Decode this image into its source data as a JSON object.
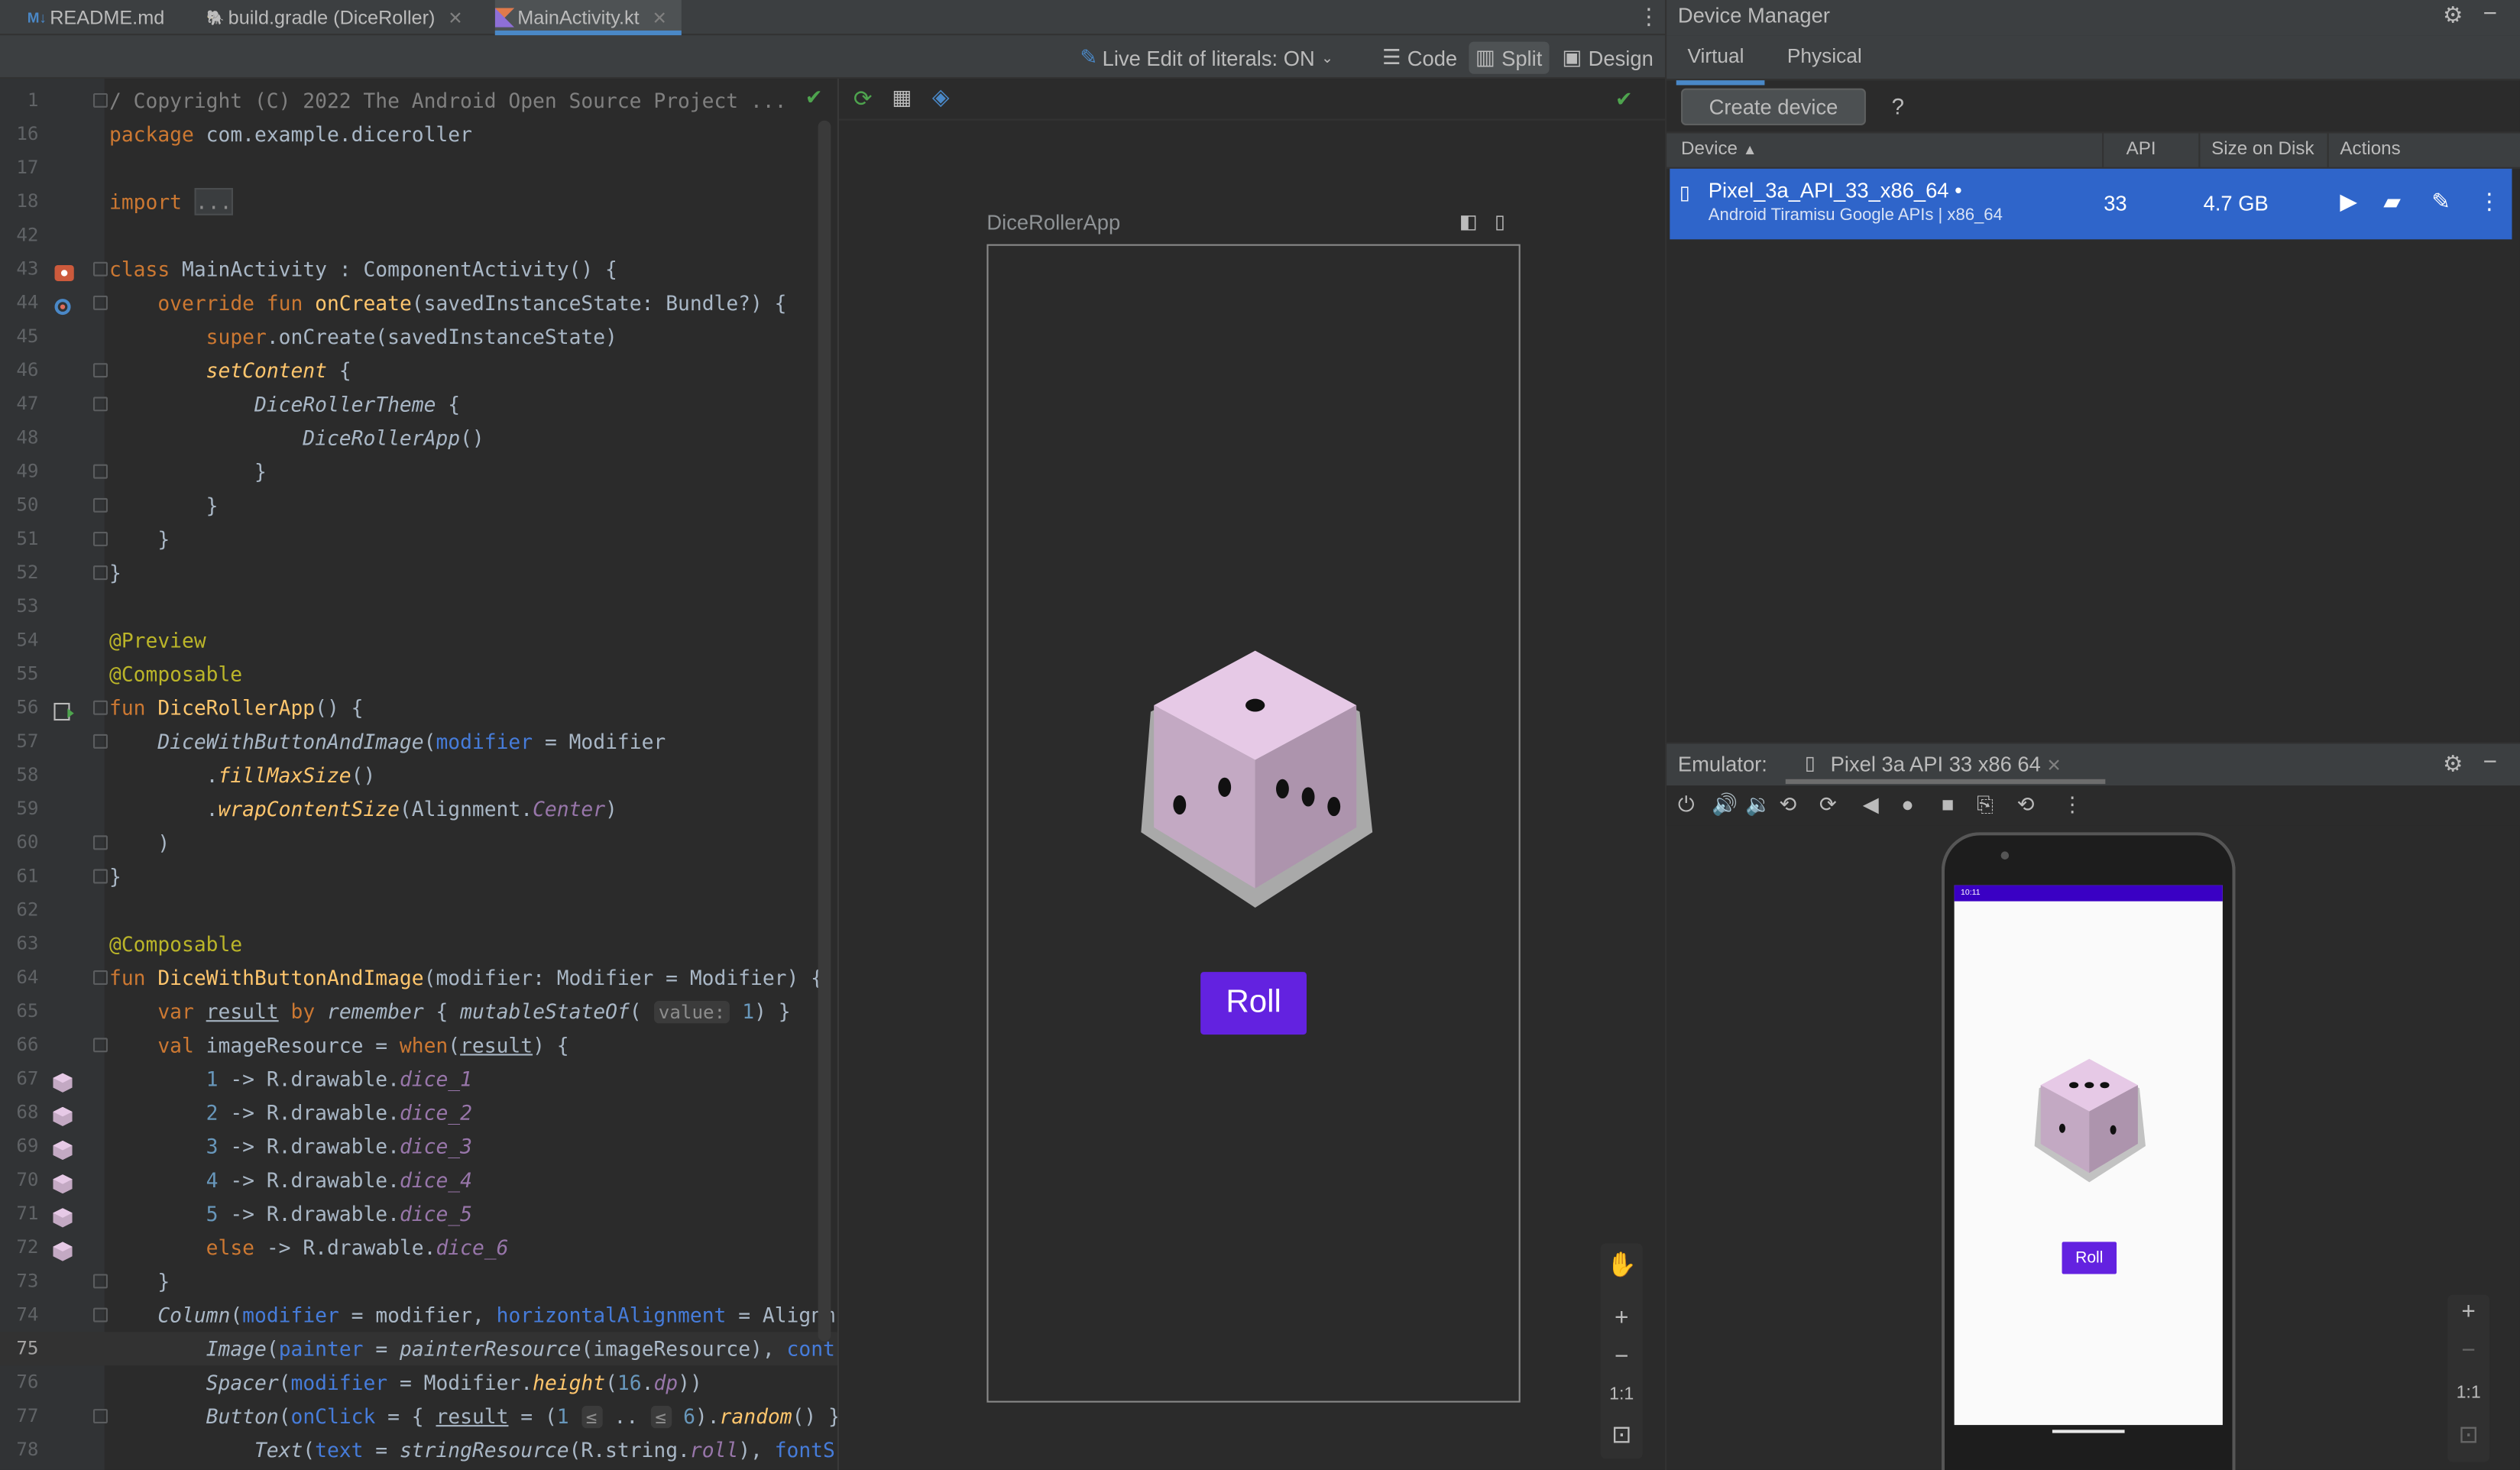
{
  "tabs": [
    {
      "label": "README.md",
      "icon": "markdown-icon"
    },
    {
      "label": "build.gradle (DiceRoller)",
      "icon": "gradle-icon"
    },
    {
      "label": "MainActivity.kt",
      "icon": "kotlin-file-icon"
    }
  ],
  "toolbar": {
    "live_edit": "Live Edit of literals: ON",
    "code": "Code",
    "split": "Split",
    "design": "Design"
  },
  "editor": {
    "current_line": "75",
    "lines": [
      {
        "n": "1",
        "html": "<span class=\"cm\">/ Copyright (C) 2022 The Android Open Source Project ...</span>"
      },
      {
        "n": "16",
        "html": "<span class=\"kw\">package</span> com.example.diceroller"
      },
      {
        "n": "17",
        "html": ""
      },
      {
        "n": "18",
        "html": "<span class=\"kw\">import</span> <span class=\"fold-box\">...</span>"
      },
      {
        "n": "42",
        "html": ""
      },
      {
        "n": "43",
        "html": "<span class=\"kw\">class</span> MainActivity : ComponentActivity() {"
      },
      {
        "n": "44",
        "html": "    <span class=\"kw\">override fun</span> <span class=\"fn\">onCreate</span>(savedInstanceState: Bundle?) {"
      },
      {
        "n": "45",
        "html": "        <span class=\"kw\">super</span>.onCreate(savedInstanceState)"
      },
      {
        "n": "46",
        "html": "        <span class=\"fn it\">setContent</span> {"
      },
      {
        "n": "47",
        "html": "            <span class=\"it\">DiceRollerTheme</span> {"
      },
      {
        "n": "48",
        "html": "                <span class=\"it\">DiceRollerApp</span>()"
      },
      {
        "n": "49",
        "html": "            }"
      },
      {
        "n": "50",
        "html": "        }"
      },
      {
        "n": "51",
        "html": "    }"
      },
      {
        "n": "52",
        "html": "}"
      },
      {
        "n": "53",
        "html": ""
      },
      {
        "n": "54",
        "html": "<span class=\"an\">@Preview</span>"
      },
      {
        "n": "55",
        "html": "<span class=\"an\">@Composable</span>"
      },
      {
        "n": "56",
        "html": "<span class=\"kw\">fun</span> <span class=\"fn\">DiceRollerApp</span>() {"
      },
      {
        "n": "57",
        "html": "    <span class=\"it\">DiceWithButtonAndImage</span>(<span class=\"pa\">modifier</span> = Modifier"
      },
      {
        "n": "58",
        "html": "        .<span class=\"fn it\">fillMaxSize</span>()"
      },
      {
        "n": "59",
        "html": "        .<span class=\"fn it\">wrapContentSize</span>(Alignment.<span class=\"st\">Center</span>)"
      },
      {
        "n": "60",
        "html": "    )"
      },
      {
        "n": "61",
        "html": "}"
      },
      {
        "n": "62",
        "html": ""
      },
      {
        "n": "63",
        "html": "<span class=\"an\">@Composable</span>"
      },
      {
        "n": "64",
        "html": "<span class=\"kw\">fun</span> <span class=\"fn\">DiceWithButtonAndImage</span>(modifier: Modifier = Modifier) {"
      },
      {
        "n": "65",
        "html": "    <span class=\"kw\">var</span> <span class=\"un\">result</span> <span class=\"kw\">by</span> <span class=\"it\">remember</span> { <span class=\"it\">mutableStateOf</span>( <span class=\"hint\">value:</span> <span class=\"nm\">1</span>) }"
      },
      {
        "n": "66",
        "html": "    <span class=\"kw\">val</span> imageResource = <span class=\"kw\">when</span>(<span class=\"un\">result</span>) {"
      },
      {
        "n": "67",
        "html": "        <span class=\"nm\">1</span> -> R.drawable.<span class=\"st\">dice_1</span>"
      },
      {
        "n": "68",
        "html": "        <span class=\"nm\">2</span> -> R.drawable.<span class=\"st\">dice_2</span>"
      },
      {
        "n": "69",
        "html": "        <span class=\"nm\">3</span> -> R.drawable.<span class=\"st\">dice_3</span>"
      },
      {
        "n": "70",
        "html": "        <span class=\"nm\">4</span> -> R.drawable.<span class=\"st\">dice_4</span>"
      },
      {
        "n": "71",
        "html": "        <span class=\"nm\">5</span> -> R.drawable.<span class=\"st\">dice_5</span>"
      },
      {
        "n": "72",
        "html": "        <span class=\"kw\">else</span> -> R.drawable.<span class=\"st\">dice_6</span>"
      },
      {
        "n": "73",
        "html": "    }"
      },
      {
        "n": "74",
        "html": "    <span class=\"it\">Column</span>(<span class=\"pa\">modifier</span> = modifier, <span class=\"pa\">horizontalAlignment</span> = Alignm"
      },
      {
        "n": "75",
        "html": "        <span class=\"it\">Image</span>(<span class=\"pa\">painter</span> = <span class=\"it\">painterResource</span>(imageResource), <span class=\"pa\">cont</span>"
      },
      {
        "n": "76",
        "html": "        <span class=\"it\">Spacer</span>(<span class=\"pa\">modifier</span> = Modifier.<span class=\"fn it\">height</span>(<span class=\"nm\">16</span>.<span class=\"st\">dp</span>))"
      },
      {
        "n": "77",
        "html": "        <span class=\"it\">Button</span>(<span class=\"pa\">onClick</span> = { <span class=\"un\">result</span> = (<span class=\"nm\">1</span> <span class=\"hint\">≤</span> .. <span class=\"hint\">≤</span> <span class=\"nm\">6</span>).<span class=\"fn it\">random</span>() }"
      },
      {
        "n": "78",
        "html": "            <span class=\"it\">Text</span>(<span class=\"pa\">text</span> = <span class=\"it\">stringResource</span>(R.string.<span class=\"st\">roll</span>), <span class=\"pa\">fontS</span>"
      }
    ]
  },
  "preview": {
    "label": "DiceRollerApp",
    "roll": "Roll",
    "fit": "1:1"
  },
  "device_manager": {
    "title": "Device Manager",
    "tab_virtual": "Virtual",
    "tab_physical": "Physical",
    "create": "Create device",
    "help": "?",
    "col_device": "Device",
    "col_api": "API",
    "col_size": "Size on Disk",
    "col_actions": "Actions",
    "device_name": "Pixel_3a_API_33_x86_64",
    "device_sub": "Android Tiramisu Google APIs | x86_64",
    "device_api": "33",
    "device_size": "4.7 GB"
  },
  "emulator": {
    "label": "Emulator:",
    "device": "Pixel 3a API 33 x86 64",
    "status_time": "10:11",
    "roll": "Roll",
    "fit": "1:1"
  },
  "colors": {
    "accent": "#6322e0",
    "selection": "#2f65ca",
    "tab_underline": "#4a88c7"
  }
}
